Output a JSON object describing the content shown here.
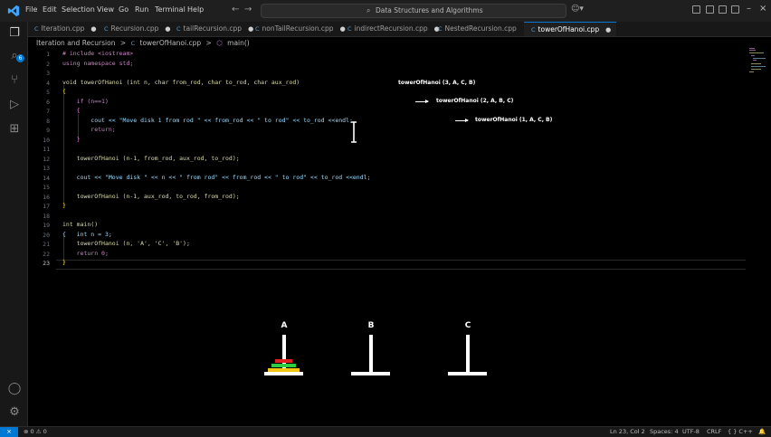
{
  "menu": [
    "File",
    "Edit",
    "Selection",
    "View",
    "Go",
    "Run",
    "Terminal",
    "Help"
  ],
  "search": {
    "text": "Data Structures and Algorithms"
  },
  "activity": {
    "badge": "6"
  },
  "tabs": [
    {
      "label": "Iteration.cpp",
      "modified": "●"
    },
    {
      "label": "Recursion.cpp",
      "modified": "●"
    },
    {
      "label": "tailRecursion.cpp",
      "modified": "●"
    },
    {
      "label": "nonTailRecursion.cpp",
      "modified": "●"
    },
    {
      "label": "indirectRecursion.cpp",
      "modified": "●"
    },
    {
      "label": "NestedRecursion.cpp",
      "modified": ""
    },
    {
      "label": "towerOfHanoi.cpp",
      "modified": "●"
    }
  ],
  "tab_icon": "C",
  "breadcrumb": {
    "folder": "Iteration and Recursion",
    "sep": ">",
    "file": "towerOfHanoi.cpp",
    "symbol": "main()"
  },
  "code": [
    {
      "ln": "1",
      "text": "# include <iostream>"
    },
    {
      "ln": "2",
      "text": "using namespace std;"
    },
    {
      "ln": "3",
      "text": ""
    },
    {
      "ln": "4",
      "text": "void towerOfHanoi (int n, char from_rod, char to_rod, char aux_rod)"
    },
    {
      "ln": "5",
      "text": "{"
    },
    {
      "ln": "6",
      "text": "    if (n==1)"
    },
    {
      "ln": "7",
      "text": "    {"
    },
    {
      "ln": "8",
      "text": "        cout << \"Move disk 1 from rod \" << from_rod << \" to rod\" << to_rod <<endl;"
    },
    {
      "ln": "9",
      "text": "        return;"
    },
    {
      "ln": "10",
      "text": "    }"
    },
    {
      "ln": "11",
      "text": ""
    },
    {
      "ln": "12",
      "text": "    towerOfHanoi (n-1, from_rod, aux_rod, to_rod);"
    },
    {
      "ln": "13",
      "text": ""
    },
    {
      "ln": "14",
      "text": "    cout << \"Move disk \" << n << \" from rod\" << from_rod << \" to rod\" << to_rod <<endl;"
    },
    {
      "ln": "15",
      "text": ""
    },
    {
      "ln": "16",
      "text": "    towerOfHanoi (n-1, aux_rod, to_rod, from_rod);"
    },
    {
      "ln": "17",
      "text": "}"
    },
    {
      "ln": "18",
      "text": ""
    },
    {
      "ln": "19",
      "text": "int main()"
    },
    {
      "ln": "20",
      "text": "{   int n = 3;"
    },
    {
      "ln": "21",
      "text": "    towerOfHanoi (n, 'A', 'C', 'B');"
    },
    {
      "ln": "22",
      "text": "    return 0;"
    },
    {
      "ln": "23",
      "text": "}"
    }
  ],
  "annotations": [
    "towerOfHanoi (3, A, C, B)",
    "towerOfHanoi (2, A, B, C)",
    "towerOfHanoi (1, A, C, B)"
  ],
  "rods": [
    "A",
    "B",
    "C"
  ],
  "disks": [
    {
      "rod": "A",
      "size": 3,
      "color": "#f1c40f"
    },
    {
      "rod": "A",
      "size": 2,
      "color": "#2ecc40"
    },
    {
      "rod": "A",
      "size": 1,
      "color": "#e02020"
    }
  ],
  "status": {
    "errors": "0",
    "warnings": "0",
    "position": "Ln 23, Col 2",
    "spaces": "Spaces: 4",
    "encoding": "UTF-8",
    "eol": "CRLF",
    "language": "C++"
  },
  "colors": {
    "accent": "#0078d4",
    "editor_bg": "#000000"
  }
}
